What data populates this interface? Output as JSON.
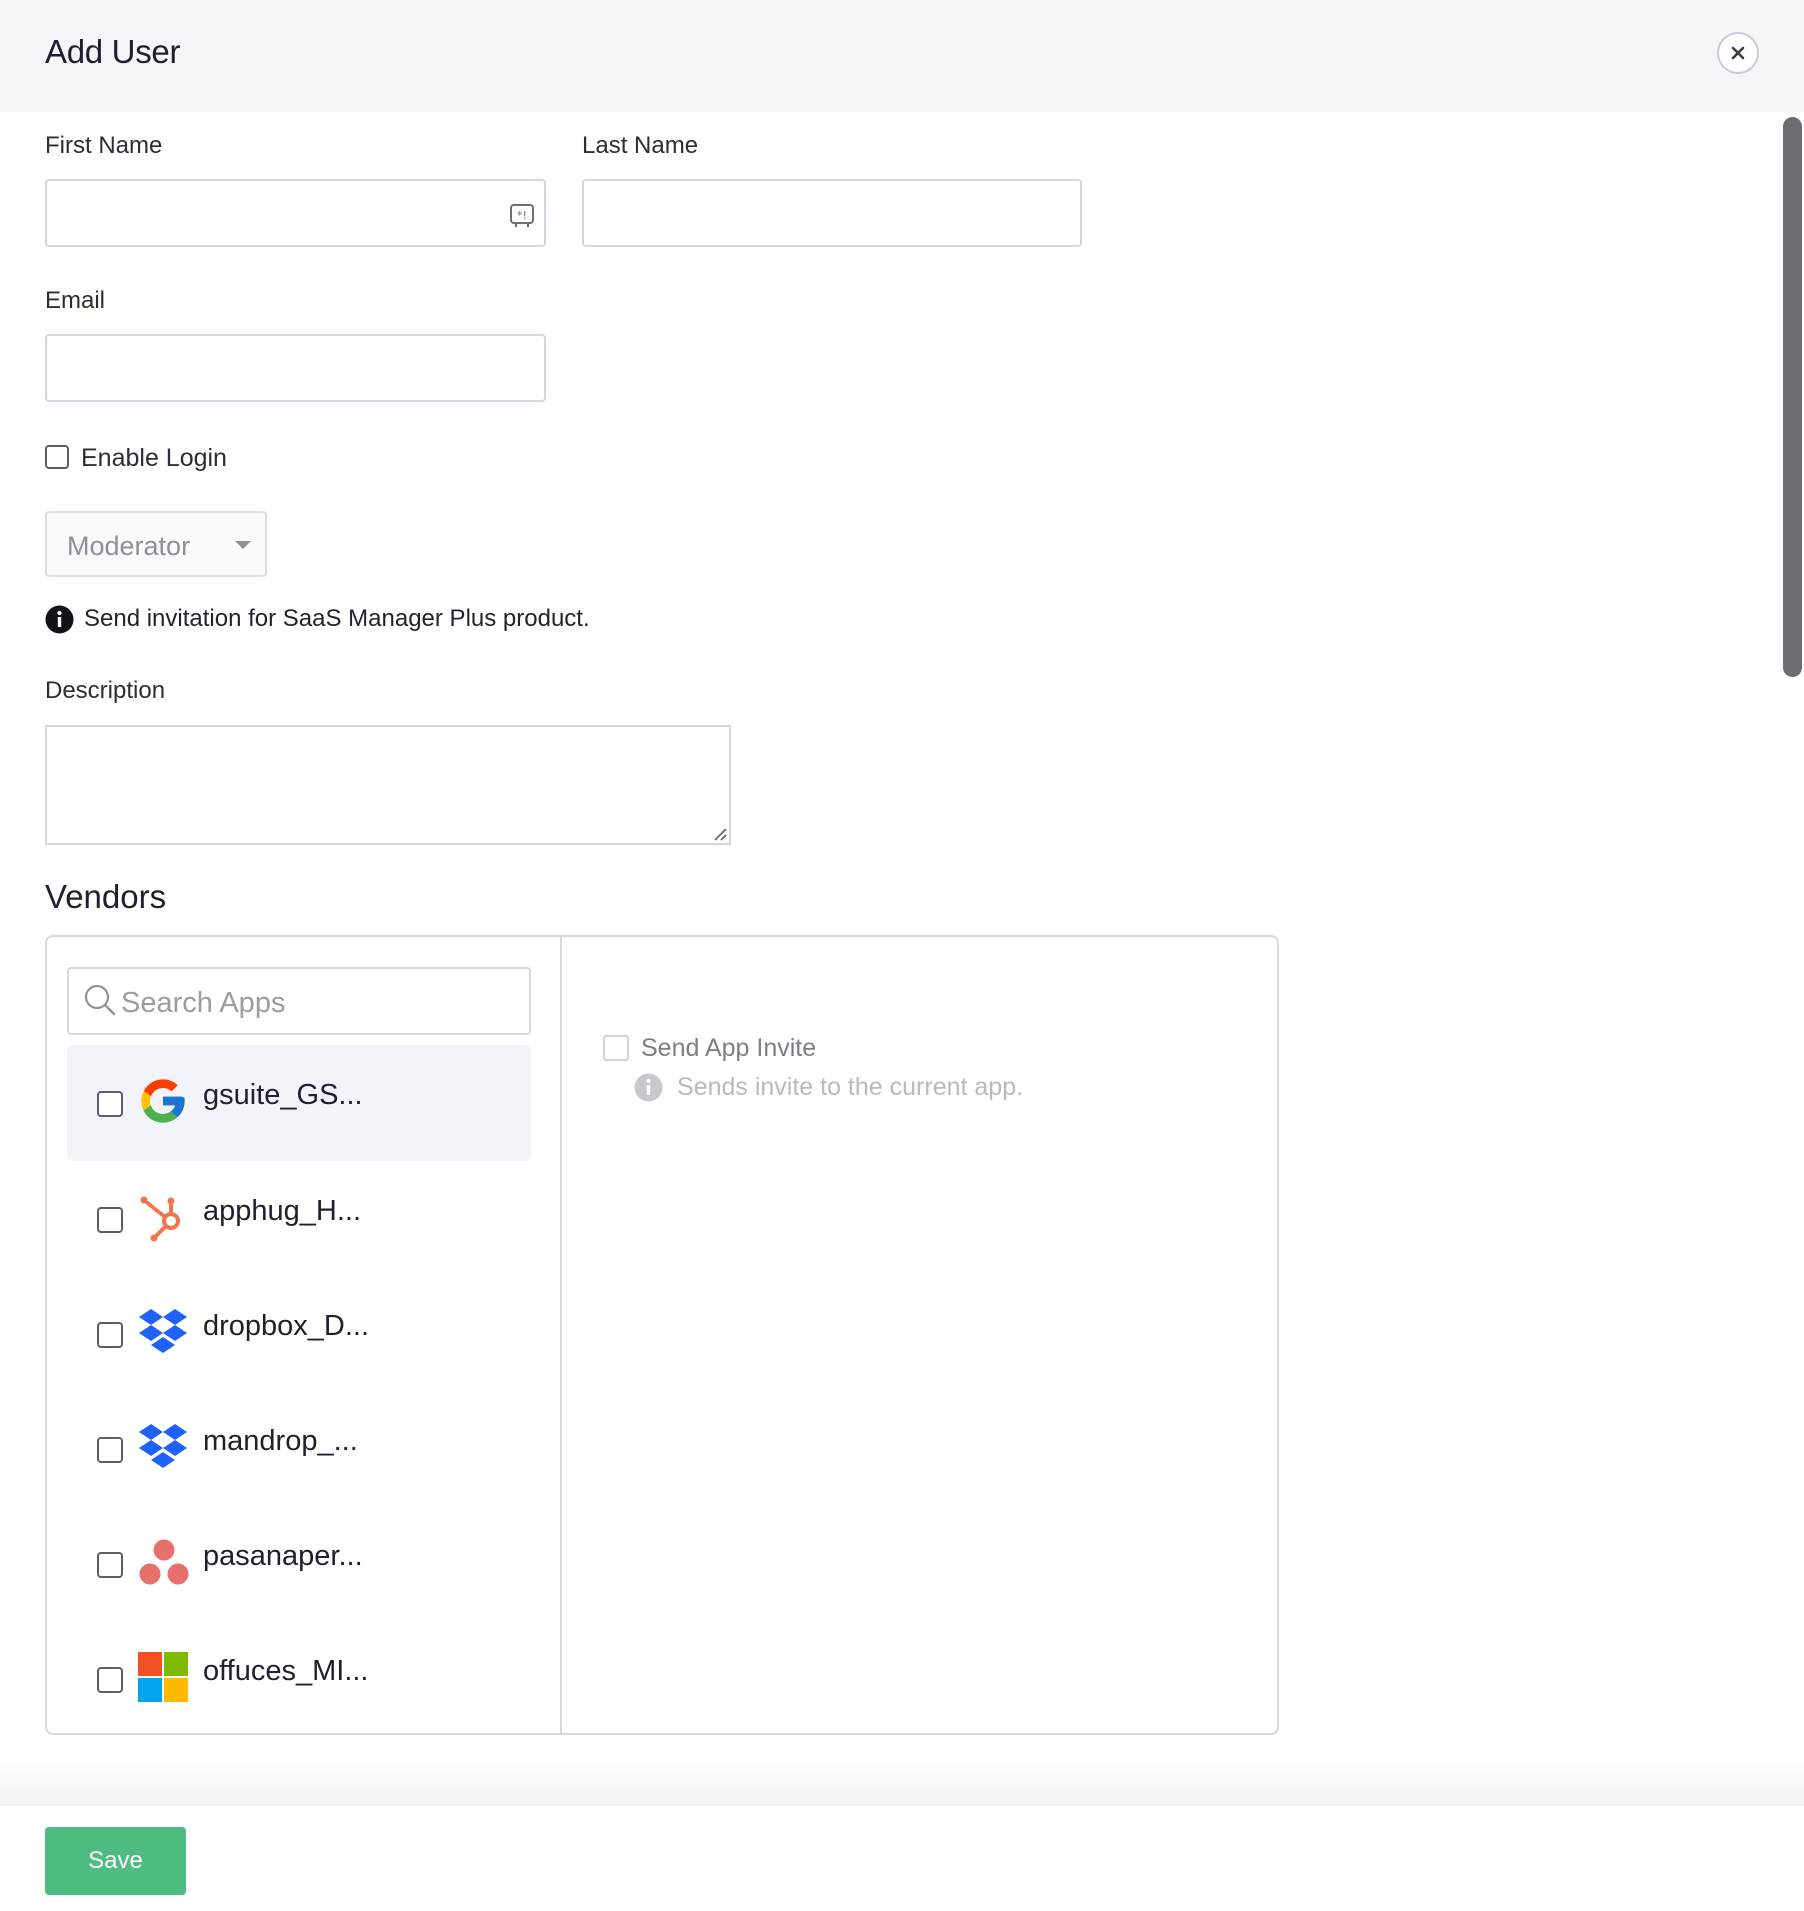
{
  "dialog": {
    "title": "Add User"
  },
  "form": {
    "first_name_label": "First Name",
    "first_name_value": "",
    "last_name_label": "Last Name",
    "last_name_value": "",
    "email_label": "Email",
    "email_value": "",
    "enable_login_label": "Enable Login",
    "enable_login_checked": false,
    "role_selected": "Moderator",
    "info_text": "Send invitation for SaaS Manager Plus product.",
    "description_label": "Description",
    "description_value": ""
  },
  "vendors": {
    "title": "Vendors",
    "search_placeholder": "Search Apps",
    "apps": [
      {
        "name": "gsuite_GS...",
        "icon": "google-icon",
        "checked": false
      },
      {
        "name": "apphug_H...",
        "icon": "hubspot-icon",
        "checked": false
      },
      {
        "name": "dropbox_D...",
        "icon": "dropbox-icon",
        "checked": false
      },
      {
        "name": "mandrop_...",
        "icon": "dropbox-icon",
        "checked": false
      },
      {
        "name": "pasanaper...",
        "icon": "asana-icon",
        "checked": false
      },
      {
        "name": "offuces_MI...",
        "icon": "microsoft-icon",
        "checked": false
      }
    ],
    "send_invite_label": "Send App Invite",
    "send_invite_desc": "Sends invite to the current app."
  },
  "footer": {
    "save_label": "Save"
  },
  "colors": {
    "header_bg": "#f5f6fa",
    "save_button": "#4ebc81",
    "border": "#d3d6e1"
  }
}
